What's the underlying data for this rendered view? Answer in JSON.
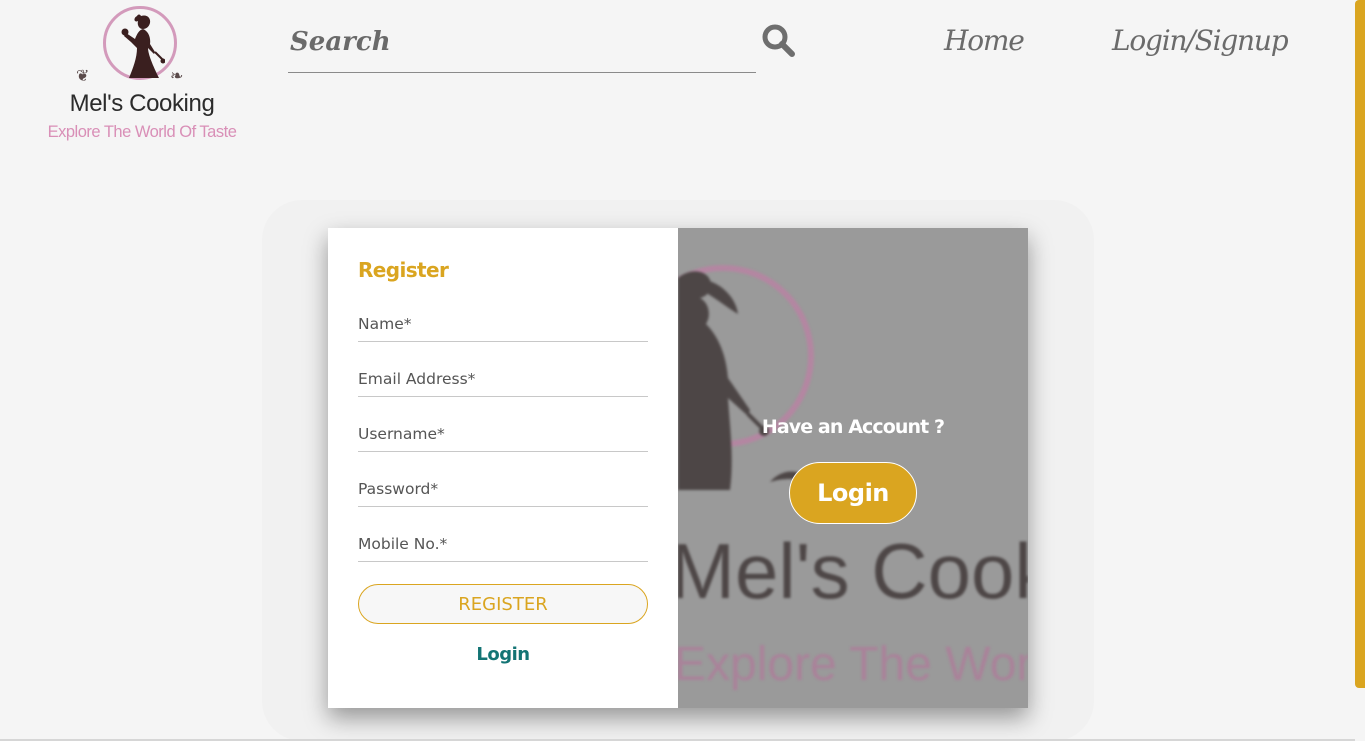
{
  "brand": {
    "name": "Mel's Cooking",
    "tagline": "Explore The World Of Taste"
  },
  "header": {
    "search_placeholder": "Search",
    "search_icon": "search-icon",
    "nav": {
      "home": "Home",
      "login_signup": "Login/Signup"
    }
  },
  "register_form": {
    "title": "Register",
    "fields": {
      "name": "Name*",
      "email": "Email Address*",
      "username": "Username*",
      "password": "Password*",
      "mobile": "Mobile No.*"
    },
    "register_button": "REGISTER",
    "login_link": "Login"
  },
  "promo": {
    "brand_name": "Mel's Cooking",
    "brand_tagline": "Explore The World Of Taste",
    "question": "Have an Account ?",
    "login_button": "Login"
  },
  "colors": {
    "accent": "#daa520",
    "link": "#137474",
    "brand_pink": "#d98fb7",
    "page_bg": "#f5f5f5"
  }
}
